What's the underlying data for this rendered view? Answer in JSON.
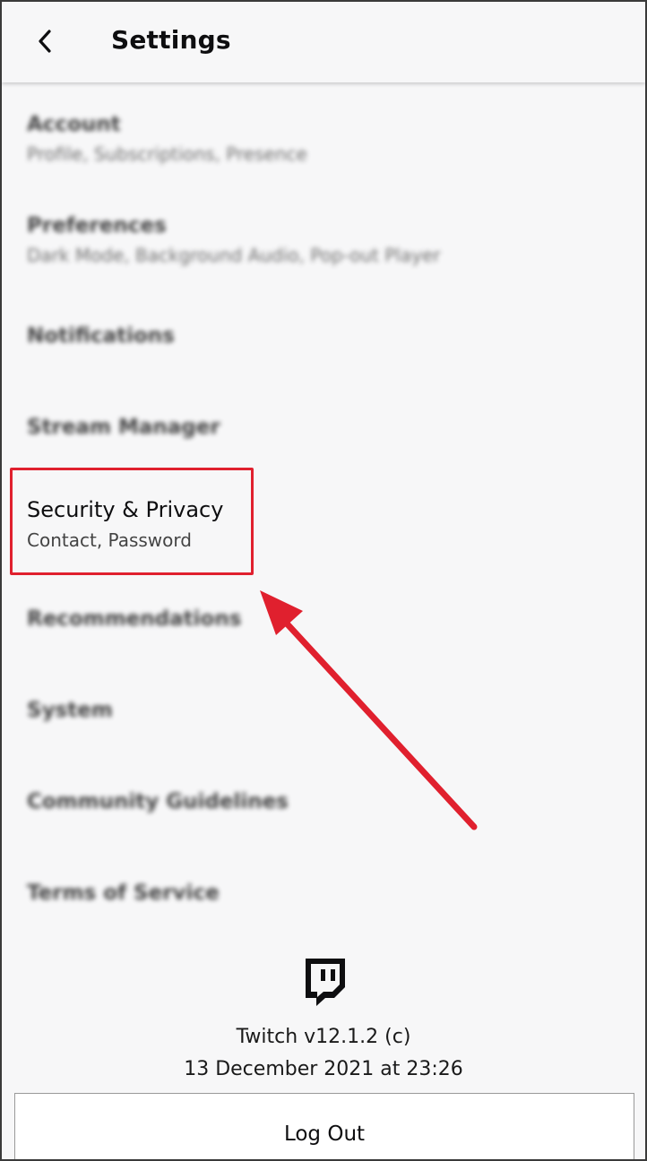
{
  "header": {
    "title": "Settings",
    "back_icon": "chevron-left-icon"
  },
  "menu": {
    "items": [
      {
        "label": "Account",
        "sub": "Profile, Subscriptions, Presence"
      },
      {
        "label": "Preferences",
        "sub": "Dark Mode, Background Audio, Pop-out Player"
      },
      {
        "label": "Notifications",
        "sub": ""
      },
      {
        "label": "Stream Manager",
        "sub": ""
      },
      {
        "label": "Security & Privacy",
        "sub": "Contact, Password"
      },
      {
        "label": "Recommendations",
        "sub": ""
      },
      {
        "label": "System",
        "sub": ""
      },
      {
        "label": "Community Guidelines",
        "sub": ""
      },
      {
        "label": "Terms of Service",
        "sub": ""
      }
    ]
  },
  "footer": {
    "logo_icon": "twitch-logo-icon",
    "version": "Twitch v12.1.2 (c)",
    "date": "13 December 2021 at 23:26",
    "logout_label": "Log Out"
  },
  "annotation": {
    "highlight_color": "#e0202e",
    "arrow_icon": "red-arrow-icon"
  }
}
